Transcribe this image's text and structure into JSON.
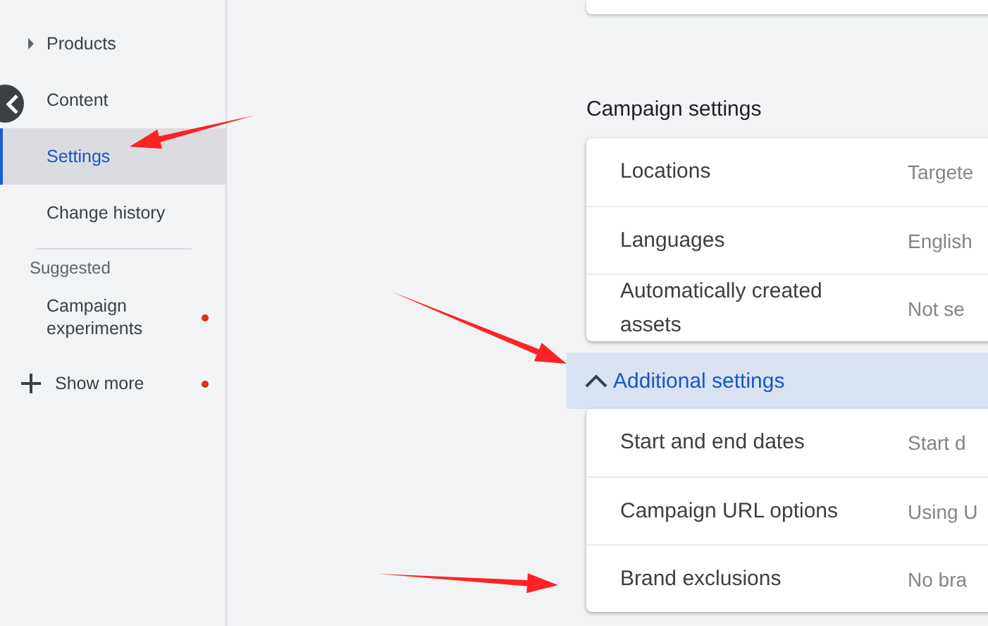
{
  "sidebar": {
    "items": [
      {
        "label": "Products",
        "kind": "expandable",
        "selected": false
      },
      {
        "label": "Content",
        "kind": "link",
        "selected": false
      },
      {
        "label": "Settings",
        "kind": "link",
        "selected": true
      },
      {
        "label": "Change history",
        "kind": "link",
        "selected": false
      }
    ],
    "section_title": "Suggested",
    "suggested": [
      {
        "label": "Campaign experiments",
        "kind": "link",
        "notification": true
      },
      {
        "label": "Show more",
        "kind": "add",
        "notification": true
      }
    ]
  },
  "campaign_settings": {
    "title": "Campaign settings",
    "rows": [
      {
        "label": "Locations",
        "value": "Targete"
      },
      {
        "label": "Languages",
        "value": "English"
      },
      {
        "label": "Automatically created assets",
        "value": "Not se"
      }
    ]
  },
  "additional_settings": {
    "label": "Additional settings",
    "expanded": true,
    "rows": [
      {
        "label": "Start and end dates",
        "value": "Start d"
      },
      {
        "label": "Campaign URL options",
        "value": "Using U"
      },
      {
        "label": "Brand exclusions",
        "value": "No bra"
      }
    ]
  }
}
